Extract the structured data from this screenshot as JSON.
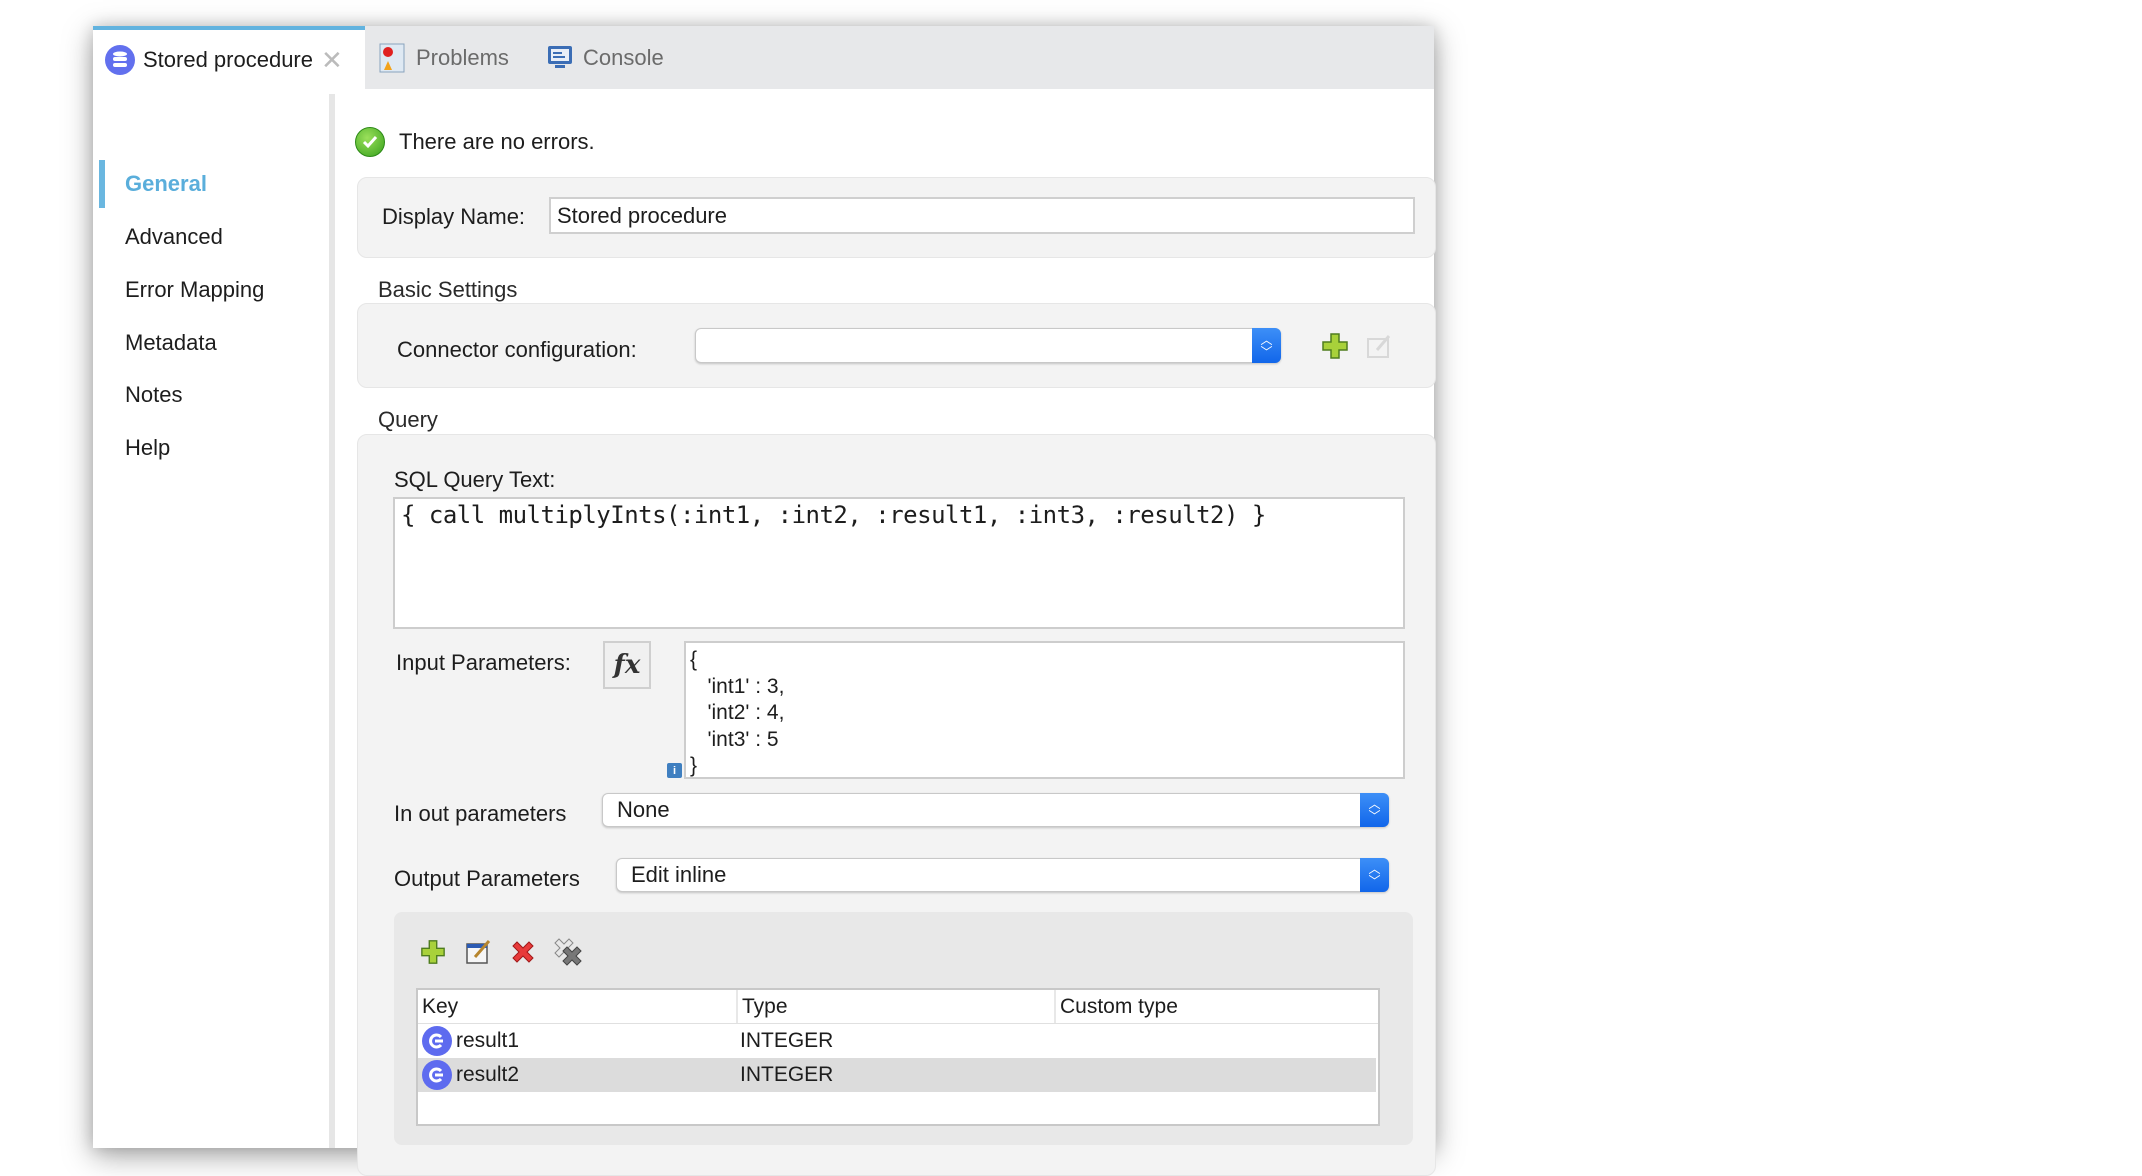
{
  "tabs": [
    {
      "label": "Stored procedure",
      "icon": "database-icon",
      "active": true,
      "closable": true
    },
    {
      "label": "Problems",
      "icon": "problems-icon",
      "active": false
    },
    {
      "label": "Console",
      "icon": "console-icon",
      "active": false
    }
  ],
  "sidebar": {
    "items": [
      {
        "label": "General",
        "active": true
      },
      {
        "label": "Advanced"
      },
      {
        "label": "Error Mapping"
      },
      {
        "label": "Metadata"
      },
      {
        "label": "Notes"
      },
      {
        "label": "Help"
      }
    ]
  },
  "status": {
    "text": "There are no errors.",
    "icon": "check-circle-icon"
  },
  "display_name": {
    "label": "Display Name:",
    "value": "Stored procedure"
  },
  "basic_settings": {
    "title": "Basic Settings",
    "connector_label": "Connector configuration:",
    "connector_value": ""
  },
  "query": {
    "title": "Query",
    "sql_label": "SQL Query Text:",
    "sql_text": "{ call multiplyInts(:int1, :int2, :result1, :int3, :result2) }",
    "input_params_label": "Input Parameters:",
    "fx_label": "fx",
    "input_params_text": "{\n   'int1' : 3,\n   'int2' : 4,\n   'int3' : 5\n}",
    "inout_label": "In out parameters",
    "inout_value": "None",
    "output_label": "Output Parameters",
    "output_value": "Edit inline"
  },
  "output_table": {
    "columns": [
      "Key",
      "Type",
      "Custom type"
    ],
    "rows": [
      {
        "key": "result1",
        "type": "INTEGER",
        "custom_type": "",
        "selected": false
      },
      {
        "key": "result2",
        "type": "INTEGER",
        "custom_type": "",
        "selected": true
      }
    ]
  },
  "colors": {
    "accent": "#5aaedb",
    "select_blue": "#1166ea",
    "row_icon": "#5e6bef"
  }
}
